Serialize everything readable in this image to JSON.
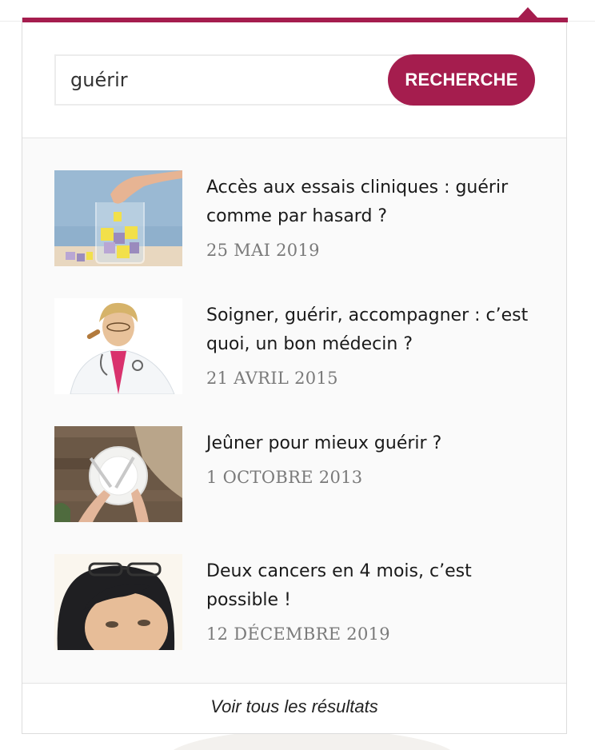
{
  "search": {
    "value": "guérir",
    "button_label": "RECHERCHE"
  },
  "results": [
    {
      "title": "Accès aux essais cliniques : guérir comme par hasard ?",
      "date": "25 MAI 2019",
      "image": "hand-dropping-pill-into-glass-jar"
    },
    {
      "title": "Soigner, guérir, accompagner : c’est quoi, un bon médecin ?",
      "date": "21 AVRIL 2015",
      "image": "confused-doctor-portrait"
    },
    {
      "title": "Jeûner pour mieux guérir ?",
      "date": "1 OCTOBRE 2013",
      "image": "empty-plate-fork-knife-on-wood"
    },
    {
      "title": "Deux cancers en 4 mois, c’est possible !",
      "date": "12 DÉCEMBRE 2019",
      "image": "woman-face-with-glasses-on-head"
    }
  ],
  "footer": {
    "see_all_label": "Voir tous les résultats"
  },
  "colors": {
    "accent": "#a51d4e",
    "panel_bg": "#fafafa",
    "date_text": "#7a7a7a"
  }
}
